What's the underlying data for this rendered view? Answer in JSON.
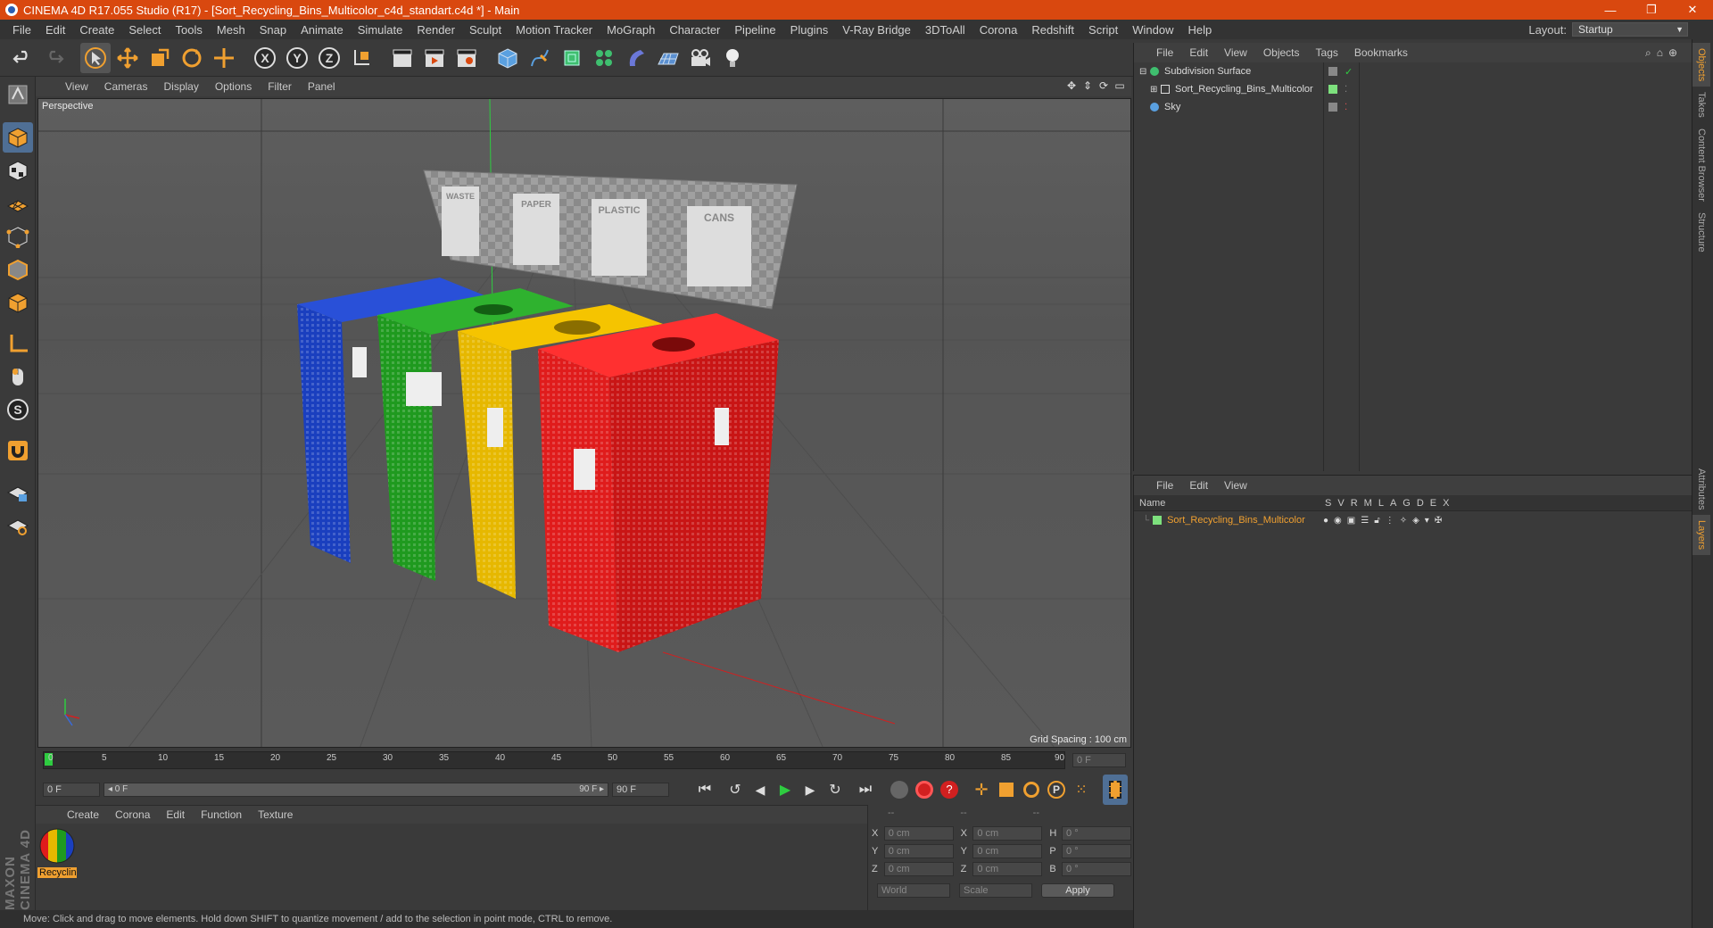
{
  "title": "CINEMA 4D R17.055 Studio (R17) - [Sort_Recycling_Bins_Multicolor_c4d_standart.c4d *] - Main",
  "window_buttons": [
    "—",
    "❐",
    "✕"
  ],
  "menu": [
    "File",
    "Edit",
    "Create",
    "Select",
    "Tools",
    "Mesh",
    "Snap",
    "Animate",
    "Simulate",
    "Render",
    "Sculpt",
    "Motion Tracker",
    "MoGraph",
    "Character",
    "Pipeline",
    "Plugins",
    "V-Ray Bridge",
    "3DToAll",
    "Corona",
    "Redshift",
    "Script",
    "Window",
    "Help"
  ],
  "layout": {
    "label": "Layout:",
    "value": "Startup"
  },
  "viewport": {
    "menu": [
      "View",
      "Cameras",
      "Display",
      "Options",
      "Filter",
      "Panel"
    ],
    "camera_label": "Perspective",
    "grid_spacing": "Grid Spacing : 100 cm",
    "signs": [
      "WASTE",
      "PAPER",
      "PLASTIC",
      "CANS"
    ]
  },
  "timeline": {
    "ticks": [
      "0",
      "5",
      "10",
      "15",
      "20",
      "25",
      "30",
      "35",
      "40",
      "45",
      "50",
      "55",
      "60",
      "65",
      "70",
      "75",
      "80",
      "85",
      "90"
    ],
    "frame_field": "0 F",
    "start_field": "0 F",
    "range_start": "◂ 0 F",
    "range_end": "90 F ▸",
    "end_field": "90 F"
  },
  "material_manager": {
    "menu": [
      "Create",
      "Corona",
      "Edit",
      "Function",
      "Texture"
    ],
    "material_name": "Recyclin"
  },
  "coord_manager": {
    "headers": [
      "--",
      "--",
      "--"
    ],
    "rows": [
      {
        "a": "X",
        "av": "0 cm",
        "b": "X",
        "bv": "0 cm",
        "c": "H",
        "cv": "0 °"
      },
      {
        "a": "Y",
        "av": "0 cm",
        "b": "Y",
        "bv": "0 cm",
        "c": "P",
        "cv": "0 °"
      },
      {
        "a": "Z",
        "av": "0 cm",
        "b": "Z",
        "bv": "0 cm",
        "c": "B",
        "cv": "0 °"
      }
    ],
    "world": "World",
    "scale": "Scale",
    "apply": "Apply"
  },
  "status": "Move: Click and drag to move elements. Hold down SHIFT to quantize movement / add to the selection in point mode, CTRL to remove.",
  "maxon_logo": "MAXON CINEMA 4D",
  "object_manager": {
    "menu": [
      "File",
      "Edit",
      "View",
      "Objects",
      "Tags",
      "Bookmarks"
    ],
    "objects": [
      {
        "name": "Subdivision Surface",
        "indent": 0
      },
      {
        "name": "Sort_Recycling_Bins_Multicolor",
        "indent": 1
      },
      {
        "name": "Sky",
        "indent": 0
      }
    ]
  },
  "layer_manager": {
    "menu": [
      "File",
      "Edit",
      "View"
    ],
    "name_header": "Name",
    "columns": [
      "S",
      "V",
      "R",
      "M",
      "L",
      "A",
      "G",
      "D",
      "E",
      "X"
    ],
    "layers": [
      {
        "name": "Sort_Recycling_Bins_Multicolor",
        "color": "#7de07d"
      }
    ]
  },
  "right_tabs": [
    "Objects",
    "Takes",
    "Content Browser",
    "Structure",
    "Attributes",
    "Layers"
  ],
  "colors": {
    "titlebar": "#d9480f",
    "accent": "#f0a030",
    "blue": "#1a3fbf",
    "green": "#1f9a1f",
    "yellow": "#e6b800",
    "red": "#e01c1c"
  }
}
